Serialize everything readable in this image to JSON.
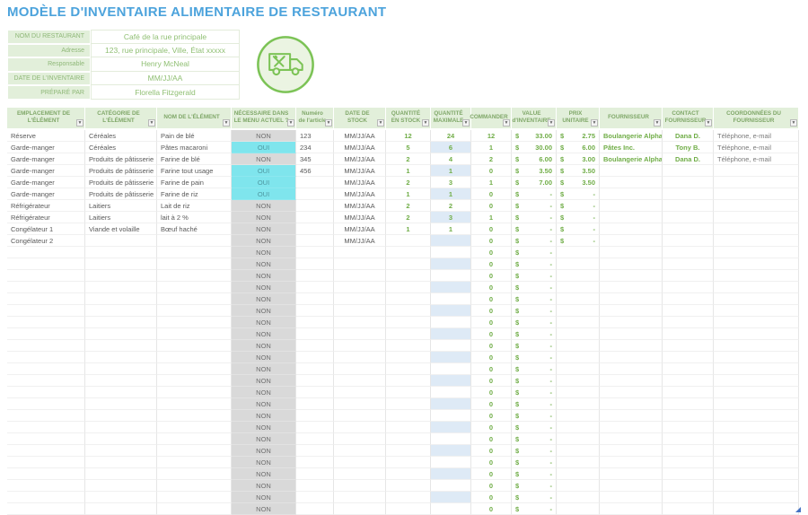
{
  "title": "MODÈLE D'INVENTAIRE ALIMENTAIRE DE RESTAURANT",
  "info_panel": {
    "fields": [
      {
        "label": "NOM DU RESTAURANT",
        "value": "Café de la rue principale"
      },
      {
        "label": "Adresse",
        "value": "123, rue principale, Ville, État xxxxx"
      },
      {
        "label": "Responsable",
        "value": "Henry McNeal"
      },
      {
        "label": "DATE DE L'INVENTAIRE",
        "value": "MM/JJ/AA"
      },
      {
        "label": "PRÉPARÉ PAR",
        "value": "Florella Fitzgerald"
      }
    ]
  },
  "icons": {
    "badge": "food-delivery-truck-icon",
    "filter_dropdown_glyph": "▼"
  },
  "table": {
    "columns": [
      {
        "id": "emplacement",
        "label": "EMPLACEMENT DE L'ÉLÉMENT"
      },
      {
        "id": "categorie",
        "label": "CATÉGORIE DE L'ÉLÉMENT"
      },
      {
        "id": "nom",
        "label": "NOM DE L'ÉLÉMENT"
      },
      {
        "id": "menu",
        "label": "NÉCESSAIRE DANS LE MENU ACTUEL ?"
      },
      {
        "id": "numero",
        "label": "Numéro de l'article"
      },
      {
        "id": "date",
        "label": "DATE DE STOCK"
      },
      {
        "id": "stock",
        "label": "QUANTITÉ EN STOCK"
      },
      {
        "id": "max",
        "label": "QUANTITÉ MAXIMALE"
      },
      {
        "id": "commander",
        "label": "COMMANDER"
      },
      {
        "id": "valeur",
        "label": "VALUE d'INVENTAIRE"
      },
      {
        "id": "prix",
        "label": "PRIX UNITAIRE"
      },
      {
        "id": "fournisseur",
        "label": "FOURNISSEUR"
      },
      {
        "id": "contact",
        "label": "CONTACT FOURNISSEUR"
      },
      {
        "id": "coordonnees",
        "label": "COORDONNÉES DU FOURNISSEUR"
      }
    ],
    "rows": [
      {
        "emplacement": "Réserve",
        "categorie": "Céréales",
        "nom": "Pain de blé",
        "menu": "NON",
        "numero": "123",
        "date": "MM/JJ/AA",
        "stock": "12",
        "max": "24",
        "commander": "12",
        "valeur": "33.00",
        "prix": "2.75",
        "fournisseur": "Boulangerie Alpha",
        "contact": "Dana D.",
        "coordonnees": "Téléphone, e-mail"
      },
      {
        "emplacement": "Garde-manger",
        "categorie": "Céréales",
        "nom": "Pâtes macaroni",
        "menu": "OUI",
        "numero": "234",
        "date": "MM/JJ/AA",
        "stock": "5",
        "max": "6",
        "commander": "1",
        "valeur": "30.00",
        "prix": "6.00",
        "fournisseur": "Pâtes Inc.",
        "contact": "Tony B.",
        "coordonnees": "Téléphone, e-mail"
      },
      {
        "emplacement": "Garde-manger",
        "categorie": "Produits de pâtisserie",
        "nom": "Farine de blé",
        "menu": "NON",
        "numero": "345",
        "date": "MM/JJ/AA",
        "stock": "2",
        "max": "4",
        "commander": "2",
        "valeur": "6.00",
        "prix": "3.00",
        "fournisseur": "Boulangerie Alpha",
        "contact": "Dana D.",
        "coordonnees": "Téléphone, e-mail"
      },
      {
        "emplacement": "Garde-manger",
        "categorie": "Produits de pâtisserie",
        "nom": "Farine tout usage",
        "menu": "OUI",
        "numero": "456",
        "date": "MM/JJ/AA",
        "stock": "1",
        "max": "1",
        "commander": "0",
        "valeur": "3.50",
        "prix": "3.50",
        "fournisseur": "",
        "contact": "",
        "coordonnees": ""
      },
      {
        "emplacement": "Garde-manger",
        "categorie": "Produits de pâtisserie",
        "nom": "Farine de pain",
        "menu": "OUI",
        "numero": "",
        "date": "MM/JJ/AA",
        "stock": "2",
        "max": "3",
        "commander": "1",
        "valeur": "7.00",
        "prix": "3.50",
        "fournisseur": "",
        "contact": "",
        "coordonnees": ""
      },
      {
        "emplacement": "Garde-manger",
        "categorie": "Produits de pâtisserie",
        "nom": "Farine de riz",
        "menu": "OUI",
        "numero": "",
        "date": "MM/JJ/AA",
        "stock": "1",
        "max": "1",
        "commander": "0",
        "valeur": "-",
        "prix": "-",
        "fournisseur": "",
        "contact": "",
        "coordonnees": ""
      },
      {
        "emplacement": "Réfrigérateur",
        "categorie": "Laitiers",
        "nom": "Lait de riz",
        "menu": "NON",
        "numero": "",
        "date": "MM/JJ/AA",
        "stock": "2",
        "max": "2",
        "commander": "0",
        "valeur": "-",
        "prix": "-",
        "fournisseur": "",
        "contact": "",
        "coordonnees": ""
      },
      {
        "emplacement": "Réfrigérateur",
        "categorie": "Laitiers",
        "nom": "lait à 2 %",
        "menu": "NON",
        "numero": "",
        "date": "MM/JJ/AA",
        "stock": "2",
        "max": "3",
        "commander": "1",
        "valeur": "-",
        "prix": "-",
        "fournisseur": "",
        "contact": "",
        "coordonnees": ""
      },
      {
        "emplacement": "Congélateur 1",
        "categorie": "Viande et volaille",
        "nom": "Bœuf haché",
        "menu": "NON",
        "numero": "",
        "date": "MM/JJ/AA",
        "stock": "1",
        "max": "1",
        "commander": "0",
        "valeur": "-",
        "prix": "-",
        "fournisseur": "",
        "contact": "",
        "coordonnees": ""
      },
      {
        "emplacement": "Congélateur 2",
        "categorie": "",
        "nom": "",
        "menu": "NON",
        "numero": "",
        "date": "MM/JJ/AA",
        "stock": "",
        "max": "",
        "commander": "0",
        "valeur": "-",
        "prix": "-",
        "fournisseur": "",
        "contact": "",
        "coordonnees": ""
      }
    ],
    "empty_row": {
      "emplacement": "",
      "categorie": "",
      "nom": "",
      "menu": "NON",
      "numero": "",
      "date": "",
      "stock": "",
      "max": "",
      "commander": "0",
      "valeur": "-",
      "prix": "",
      "fournisseur": "",
      "contact": "",
      "coordonnees": ""
    },
    "empty_row_count": 23,
    "currency_symbol": "$"
  },
  "colors": {
    "title_blue": "#4CA3DC",
    "accent_green": "#70AD47",
    "header_bg_green": "#E2EFDA",
    "header_text_green": "#7FA768",
    "form_text_green": "#8FBF72",
    "non_bg": "#D9D9D9",
    "oui_bg": "#7FE5ED",
    "oui_text": "#4E97A0",
    "alt_blue": "#DEEAF6",
    "body_text_gray": "#595959",
    "icon_green": "#7CC356",
    "icon_fill": "#EBF4E2",
    "corner_mark_blue": "#4472C4"
  }
}
